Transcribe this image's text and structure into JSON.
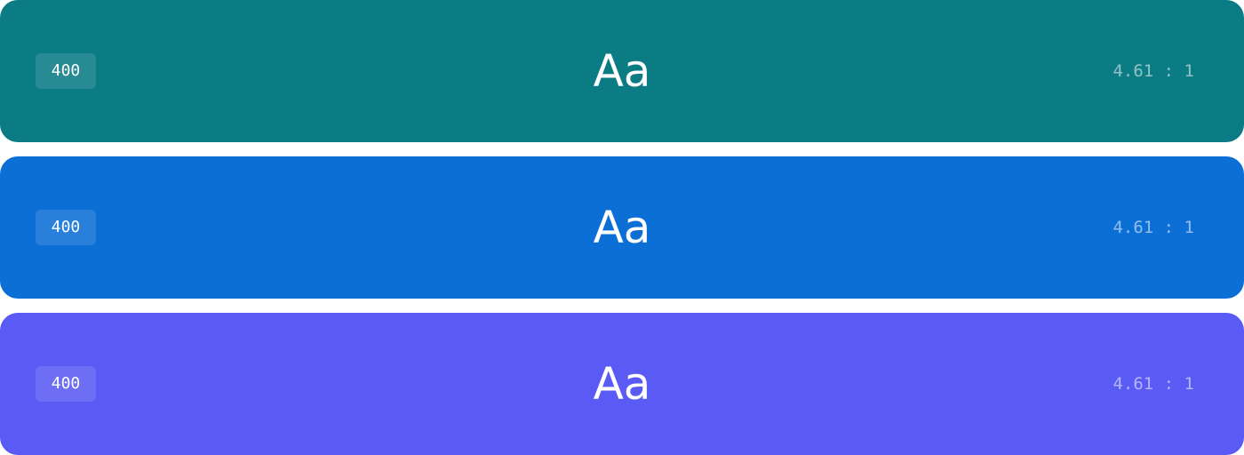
{
  "swatches": [
    {
      "color": "#0b7b84",
      "weight": "400",
      "sample": "Aa",
      "contrast": "4.61 : 1"
    },
    {
      "color": "#0c6fd6",
      "weight": "400",
      "sample": "Aa",
      "contrast": "4.61 : 1"
    },
    {
      "color": "#5a5af4",
      "weight": "400",
      "sample": "Aa",
      "contrast": "4.61 : 1"
    }
  ]
}
